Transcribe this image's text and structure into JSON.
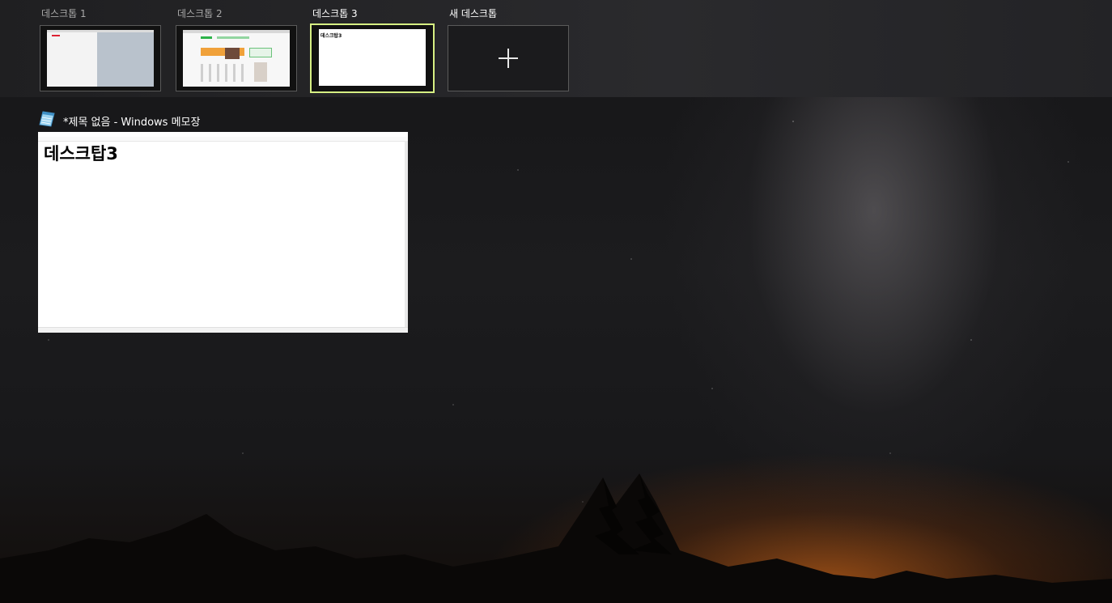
{
  "desktops": [
    {
      "label": "데스크톱 1",
      "active": false
    },
    {
      "label": "데스크톱 2",
      "active": false
    },
    {
      "label": "데스크톱 3",
      "active": true
    }
  ],
  "new_desktop": {
    "label": "새 데스크톱",
    "icon": "plus-icon"
  },
  "window": {
    "title": "*제목 없음 - Windows 메모장",
    "icon": "notepad-icon",
    "content_text": "데스크탑3"
  },
  "colors": {
    "active_border": "#d6ef83",
    "topbar_bg": "#252527"
  }
}
